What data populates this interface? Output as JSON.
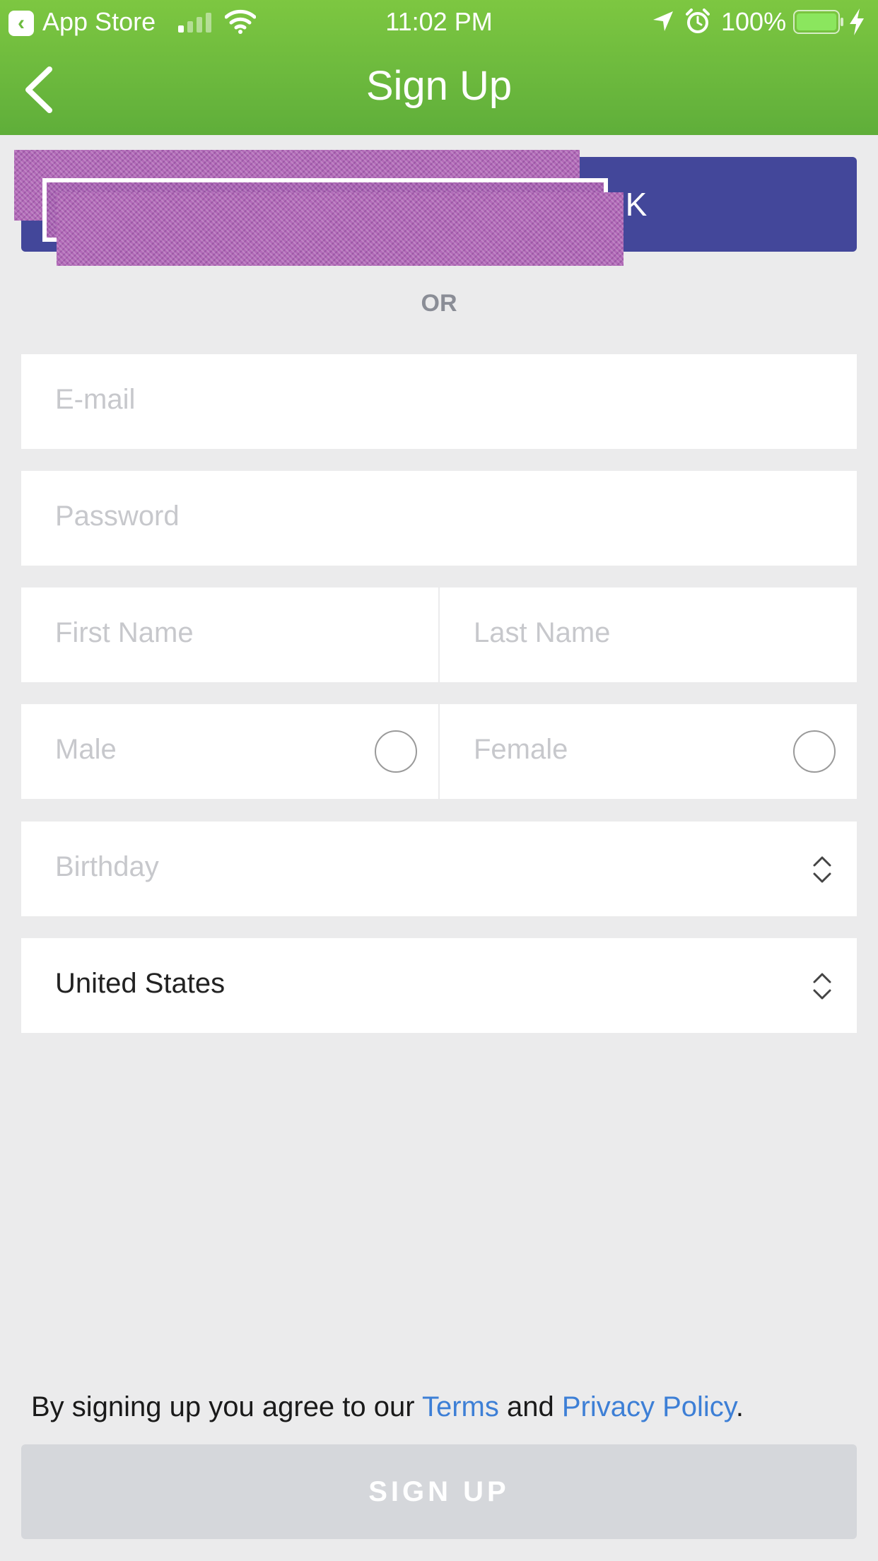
{
  "status_bar": {
    "back_app": "App Store",
    "time": "11:02 PM",
    "battery_percent": "100%"
  },
  "nav": {
    "title": "Sign Up"
  },
  "social": {
    "label": "K"
  },
  "divider_text": "OR",
  "form": {
    "email_placeholder": "E-mail",
    "password_placeholder": "Password",
    "first_name_placeholder": "First Name",
    "last_name_placeholder": "Last Name",
    "gender_male": "Male",
    "gender_female": "Female",
    "birthday_placeholder": "Birthday",
    "country_value": "United States"
  },
  "footer": {
    "terms_prefix": "By signing up you agree to our ",
    "terms_link": "Terms",
    "terms_and": " and ",
    "privacy_link": "Privacy Policy",
    "terms_suffix": ".",
    "signup_label": "SIGN UP"
  },
  "colors": {
    "header_top": "#7dc741",
    "header_bottom": "#5fae3a",
    "social_button": "#43479a",
    "link": "#3d7fd6",
    "disabled_button": "#d5d7db"
  }
}
